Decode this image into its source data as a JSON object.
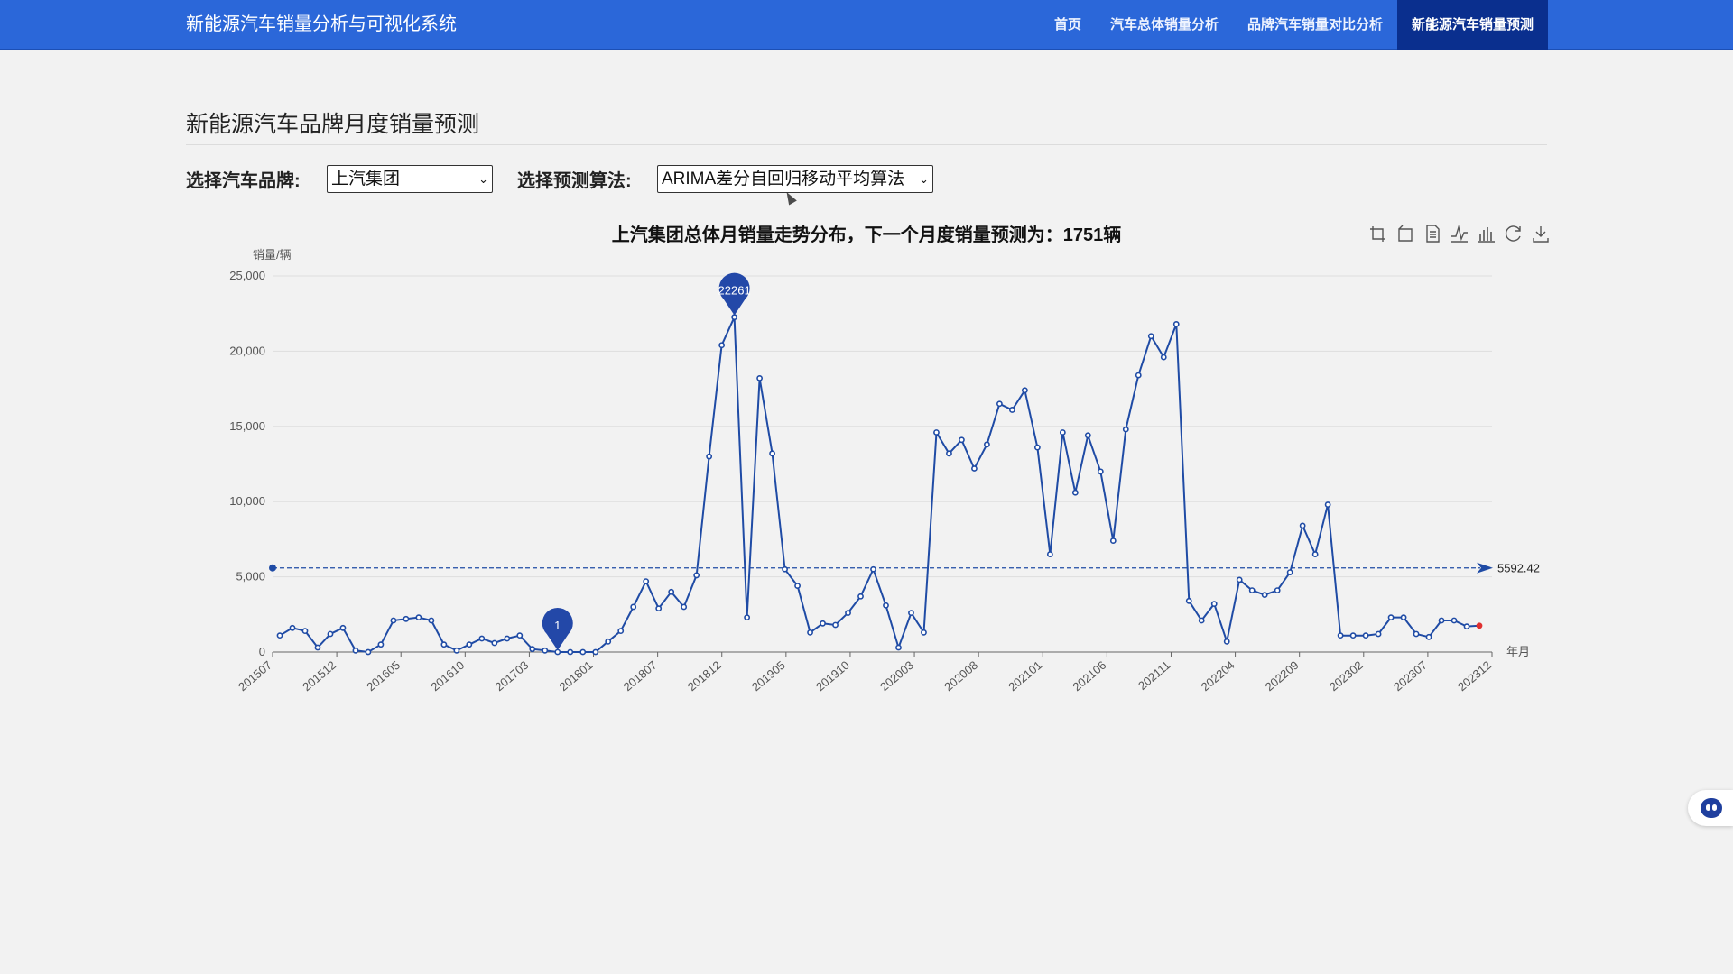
{
  "app": {
    "title": "新能源汽车销量分析与可视化系统"
  },
  "nav": {
    "items": [
      {
        "label": "首页"
      },
      {
        "label": "汽车总体销量分析"
      },
      {
        "label": "品牌汽车销量对比分析"
      },
      {
        "label": "新能源汽车销量预测"
      }
    ],
    "active": "新能源汽车销量预测"
  },
  "page": {
    "title": "新能源汽车品牌月度销量预测"
  },
  "filters": {
    "brand_label": "选择汽车品牌:",
    "brand_value": "上汽集团",
    "algorithm_label": "选择预测算法:",
    "algorithm_value": "ARIMA差分自回归移动平均算法"
  },
  "colors": {
    "navbar": "#2b67d9",
    "nav_active": "#0a2f8e",
    "series_line": "#1f4ba5",
    "point_fill": "#ffffff",
    "last_point": "#e03030",
    "background": "#f2f2f2"
  },
  "toolbox": {
    "icons": [
      "zoom-icon",
      "zoom-reset-icon",
      "data-view-icon",
      "line-chart-icon",
      "bar-chart-icon",
      "refresh-icon",
      "download-icon"
    ]
  },
  "chart_data": {
    "type": "line",
    "title": "上汽集团总体月销量走势分布，下一个月度销量预测为：1751辆",
    "ylabel": "销量/辆",
    "xlabel": "年月",
    "ylim": [
      0,
      25000
    ],
    "y_ticks": [
      "0",
      "5,000",
      "10,000",
      "15,000",
      "20,000",
      "25,000"
    ],
    "x_tick_labels": [
      "201507",
      "201512",
      "201605",
      "201610",
      "201703",
      "201801",
      "201807",
      "201812",
      "201905",
      "201910",
      "202003",
      "202008",
      "202101",
      "202106",
      "202111",
      "202204",
      "202209",
      "202302",
      "202307",
      "202312"
    ],
    "grid": true,
    "legend": "none",
    "mean_line": {
      "value": 5592.42,
      "label": "5592.42"
    },
    "max_marker": {
      "label": "22261",
      "value": 22261
    },
    "min_marker": {
      "label": "1",
      "value": 1
    },
    "series": [
      {
        "values": [
          1100,
          1600,
          1400,
          300,
          1200,
          1600,
          100,
          0,
          500,
          2100,
          2200,
          2300,
          2100,
          500,
          100,
          500,
          900,
          600,
          900,
          1100,
          200,
          100,
          1,
          0,
          0,
          0,
          700,
          1400,
          3000,
          4700,
          2900,
          4000,
          3000,
          5100,
          13000,
          20400,
          22261,
          2300,
          18200,
          13200,
          5500,
          4400,
          1300,
          1900,
          1800,
          2600,
          3700,
          5500,
          3100,
          300,
          2600,
          1300,
          14600,
          13200,
          14100,
          12200,
          13800,
          16500,
          16100,
          17400,
          13600,
          6500,
          14600,
          10600,
          14400,
          12000,
          7400,
          14800,
          18400,
          21000,
          19600,
          21800,
          3400,
          2100,
          3200,
          700,
          4800,
          4100,
          3800,
          4100,
          5300,
          8400,
          6500,
          9800,
          1100,
          1100,
          1100,
          1200,
          2300,
          2300,
          1200,
          1000,
          2100,
          2100,
          1700,
          1751
        ]
      }
    ]
  }
}
